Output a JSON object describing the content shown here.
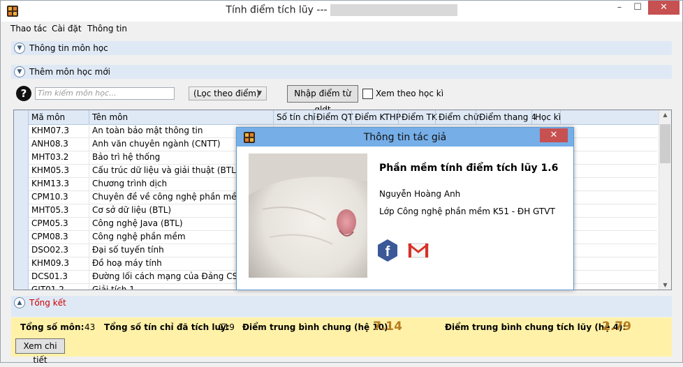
{
  "window": {
    "title": "Tính điểm tích lũy ---",
    "minimize": "–",
    "maximize": "☐",
    "close": "✕"
  },
  "menu": [
    "Thao tác",
    "Cài đặt",
    "Thông tin"
  ],
  "sections": {
    "info": "Thông tin môn học",
    "add": "Thêm môn học mới",
    "summary": "Tổng kết"
  },
  "toolbar": {
    "search_placeholder": "Tìm kiếm môn học...",
    "filter": "(Lọc theo điểm)",
    "import_button": "Nhập điểm từ qldt",
    "semester_checkbox": "Xem theo học kì"
  },
  "table": {
    "columns": [
      "Mã môn",
      "Tên môn",
      "Số tín chỉ",
      "Điểm QT",
      "Điểm KTHP",
      "Điểm TK",
      "Điểm chữ",
      "Điểm thang 4",
      "Học kì"
    ],
    "rows": [
      [
        "KHM07.3",
        "An toàn bảo mật thông tin"
      ],
      [
        "ANH08.3",
        "Anh văn chuyên ngành (CNTT)"
      ],
      [
        "MHT03.2",
        "Bảo trì hệ thống"
      ],
      [
        "KHM05.3",
        "Cấu trúc dữ liệu và giải thuật (BTL)"
      ],
      [
        "KHM13.3",
        "Chương trình dịch"
      ],
      [
        "CPM10.3",
        "Chuyên đề về công nghệ phần mềm (BTL)"
      ],
      [
        "MHT05.3",
        "Cơ sở dữ liệu (BTL)"
      ],
      [
        "CPM05.3",
        "Công nghệ Java (BTL)"
      ],
      [
        "CPM08.3",
        "Công nghệ phần mềm"
      ],
      [
        "DSO02.3",
        "Đại số tuyến tính"
      ],
      [
        "KHM09.3",
        "Đồ hoạ máy tính"
      ],
      [
        "DCS01.3",
        "Đường lối cách mạng của Đảng CSVN"
      ],
      [
        "GIT01.2",
        "Giải tích 1"
      ]
    ]
  },
  "summary": {
    "total_subjects_label": "Tổng số môn:",
    "total_subjects": "43",
    "total_credits_label": "Tổng số tín chỉ đã tích luỹ:",
    "total_credits": "119",
    "avg10_label": "Điểm trung bình chung (hệ 10):",
    "avg10": "7.14",
    "avg4_label": "Điểm trung bình chung tích lũy (hệ 4):",
    "avg4": "2.79",
    "detail_button": "Xem chi tiết"
  },
  "dialog": {
    "title": "Thông tin tác giả",
    "close": "✕",
    "heading": "Phần mềm tính điểm tích lũy 1.6",
    "author": "Nguyễn Hoàng Anh",
    "class": "Lớp Công nghệ phần mềm K51 - ĐH GTVT",
    "facebook_glyph": "f"
  },
  "colors": {
    "accent": "#76aee8",
    "close": "#c75050",
    "summary_bg": "#fff2a8",
    "big_value": "#b87b1f",
    "section_bg": "#dfe9f6",
    "summary_title": "#cc0000"
  }
}
